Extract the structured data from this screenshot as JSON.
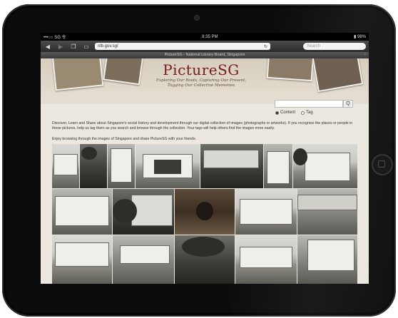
{
  "statusbar": {
    "carrier": "•••○○ SG 令",
    "time": "8:35 PM",
    "battery": "▮ 98%"
  },
  "browser": {
    "url": "nlb.gov.sg/",
    "search_placeholder": "Search",
    "page_title": "PictureSG - National Library Board, Singapore"
  },
  "site": {
    "logo_title": "PictureSG",
    "tagline_line1": "Exploring Our Roots, Capturing Our Present,",
    "tagline_line2": "Tagging Our Collective Memories",
    "search_button": "Q",
    "radio_content": "Content",
    "radio_tag": "Tag",
    "intro": "Discover, Learn and Share about Singapore's social history and development through our digital collection of images (photographs or artworks). If you recognise the places or people in these pictures, help us tag them as you search and browse through the collection. Your tags will help others find the images more easily.",
    "enjoy": "Enjoy browsing through the images of Singapore and share PictureSG with your friends."
  },
  "icons": {
    "back": "◀",
    "forward": "▶",
    "bookmarks": "❐",
    "tabs": "▭",
    "reload": "↻"
  }
}
